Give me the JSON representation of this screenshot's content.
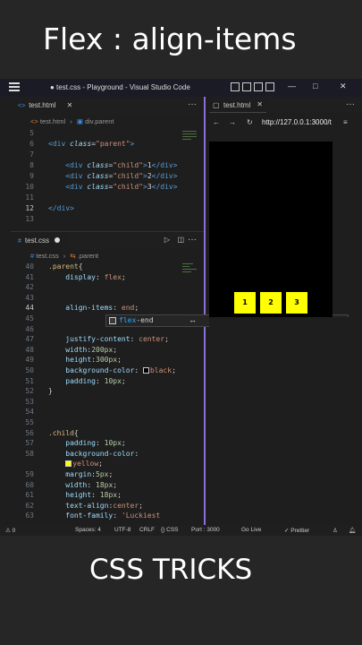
{
  "hero": {
    "title": "Flex : align-items"
  },
  "footer": {
    "title": "CSS TRICKS"
  },
  "window": {
    "title": "● test.css - Playground - Visual Studio Code",
    "minimize": "—",
    "maximize": "□",
    "close": "✕"
  },
  "top_editor": {
    "tab_label": "test.html",
    "breadcrumb_file": "test.html",
    "breadcrumb_node": "div.parent",
    "lines": [
      {
        "n": "5",
        "html": ""
      },
      {
        "n": "6",
        "html": "<span class=\"tag\">&lt;div</span> <span class=\"attr\">class</span>=<span class=\"str\">\"parent\"</span><span class=\"tag\">&gt;</span>"
      },
      {
        "n": "7",
        "html": ""
      },
      {
        "n": "8",
        "html": "    <span class=\"tag\">&lt;div</span> <span class=\"attr\">class</span>=<span class=\"str\">\"child\"</span><span class=\"tag\">&gt;</span>1<span class=\"tag\">&lt;/div&gt;</span>"
      },
      {
        "n": "9",
        "html": "    <span class=\"tag\">&lt;div</span> <span class=\"attr\">class</span>=<span class=\"str\">\"child\"</span><span class=\"tag\">&gt;</span>2<span class=\"tag\">&lt;/div&gt;</span>"
      },
      {
        "n": "10",
        "html": "    <span class=\"tag\">&lt;div</span> <span class=\"attr\">class</span>=<span class=\"str\">\"child\"</span><span class=\"tag\">&gt;</span>3<span class=\"tag\">&lt;/div&gt;</span>"
      },
      {
        "n": "11",
        "html": ""
      },
      {
        "n": "12",
        "html": "<span class=\"tag\">&lt;/div&gt;</span>"
      },
      {
        "n": "13",
        "html": ""
      }
    ]
  },
  "bottom_editor": {
    "tab_label": "test.css",
    "breadcrumb_file": "test.css",
    "breadcrumb_node": ".parent",
    "lines": [
      {
        "n": "40",
        "html": "<span class=\"sel\">.parent</span><span class=\"pun\">{</span>"
      },
      {
        "n": "41",
        "html": "    <span class=\"prop\">display</span>: <span class=\"val\">flex</span>;"
      },
      {
        "n": "42",
        "html": ""
      },
      {
        "n": "43",
        "html": ""
      },
      {
        "n": "44",
        "html": "    <span class=\"prop\">align-items</span>: <span class=\"val\">end</span>;"
      },
      {
        "n": "45",
        "html": ""
      },
      {
        "n": "46",
        "html": ""
      },
      {
        "n": "47",
        "html": "    <span class=\"prop\">justify-content</span>: <span class=\"val\">center</span>;"
      },
      {
        "n": "48",
        "html": "    <span class=\"prop\">width</span>:<span class=\"num\">200px</span>;"
      },
      {
        "n": "49",
        "html": "    <span class=\"prop\">height</span>:<span class=\"num\">300px</span>;"
      },
      {
        "n": "50",
        "html": "    <span class=\"prop\">background-color</span>: <span class=\"swatch\" style=\"background:#000\"></span><span class=\"val\">black</span>;"
      },
      {
        "n": "51",
        "html": "    <span class=\"prop\">padding</span>: <span class=\"num\">10px</span>;"
      },
      {
        "n": "52",
        "html": "<span class=\"pun\">}</span>"
      },
      {
        "n": "53",
        "html": ""
      },
      {
        "n": "54",
        "html": ""
      },
      {
        "n": "55",
        "html": ""
      },
      {
        "n": "56",
        "html": "<span class=\"sel\">.child</span><span class=\"pun\">{</span>"
      },
      {
        "n": "57",
        "html": "    <span class=\"prop\">padding</span>: <span class=\"num\">10px</span>;"
      },
      {
        "n": "58",
        "html": "    <span class=\"prop\">background-color</span>:"
      },
      {
        "n": "",
        "html": "    <span class=\"swatch\" style=\"background:#ff0\"></span><span class=\"val\">yellow</span>;"
      },
      {
        "n": "59",
        "html": "    <span class=\"prop\">margin</span>:<span class=\"num\">5px</span>;"
      },
      {
        "n": "60",
        "html": "    <span class=\"prop\">width</span>: <span class=\"num\">18px</span>;"
      },
      {
        "n": "61",
        "html": "    <span class=\"prop\">height</span>: <span class=\"num\">18px</span>;"
      },
      {
        "n": "62",
        "html": "    <span class=\"prop\">text-align</span>:<span class=\"val\">center</span>;"
      },
      {
        "n": "63",
        "html": "    <span class=\"prop\">font-family</span>: <span class=\"val\">'Luckiest</span>"
      }
    ],
    "suggestion": "flex-end"
  },
  "browser": {
    "tab_label": "test.html",
    "url": "http://127.0.0.1:3000/t",
    "children": [
      "1",
      "2",
      "3"
    ]
  },
  "statusbar": {
    "errors": "⚠ 0",
    "spaces": "Spaces: 4",
    "encoding": "UTF-8",
    "eol": "CRLF",
    "lang": "{} CSS",
    "port": "Port : 3000",
    "live": "Go Live",
    "prettier": "✓ Prettier"
  }
}
